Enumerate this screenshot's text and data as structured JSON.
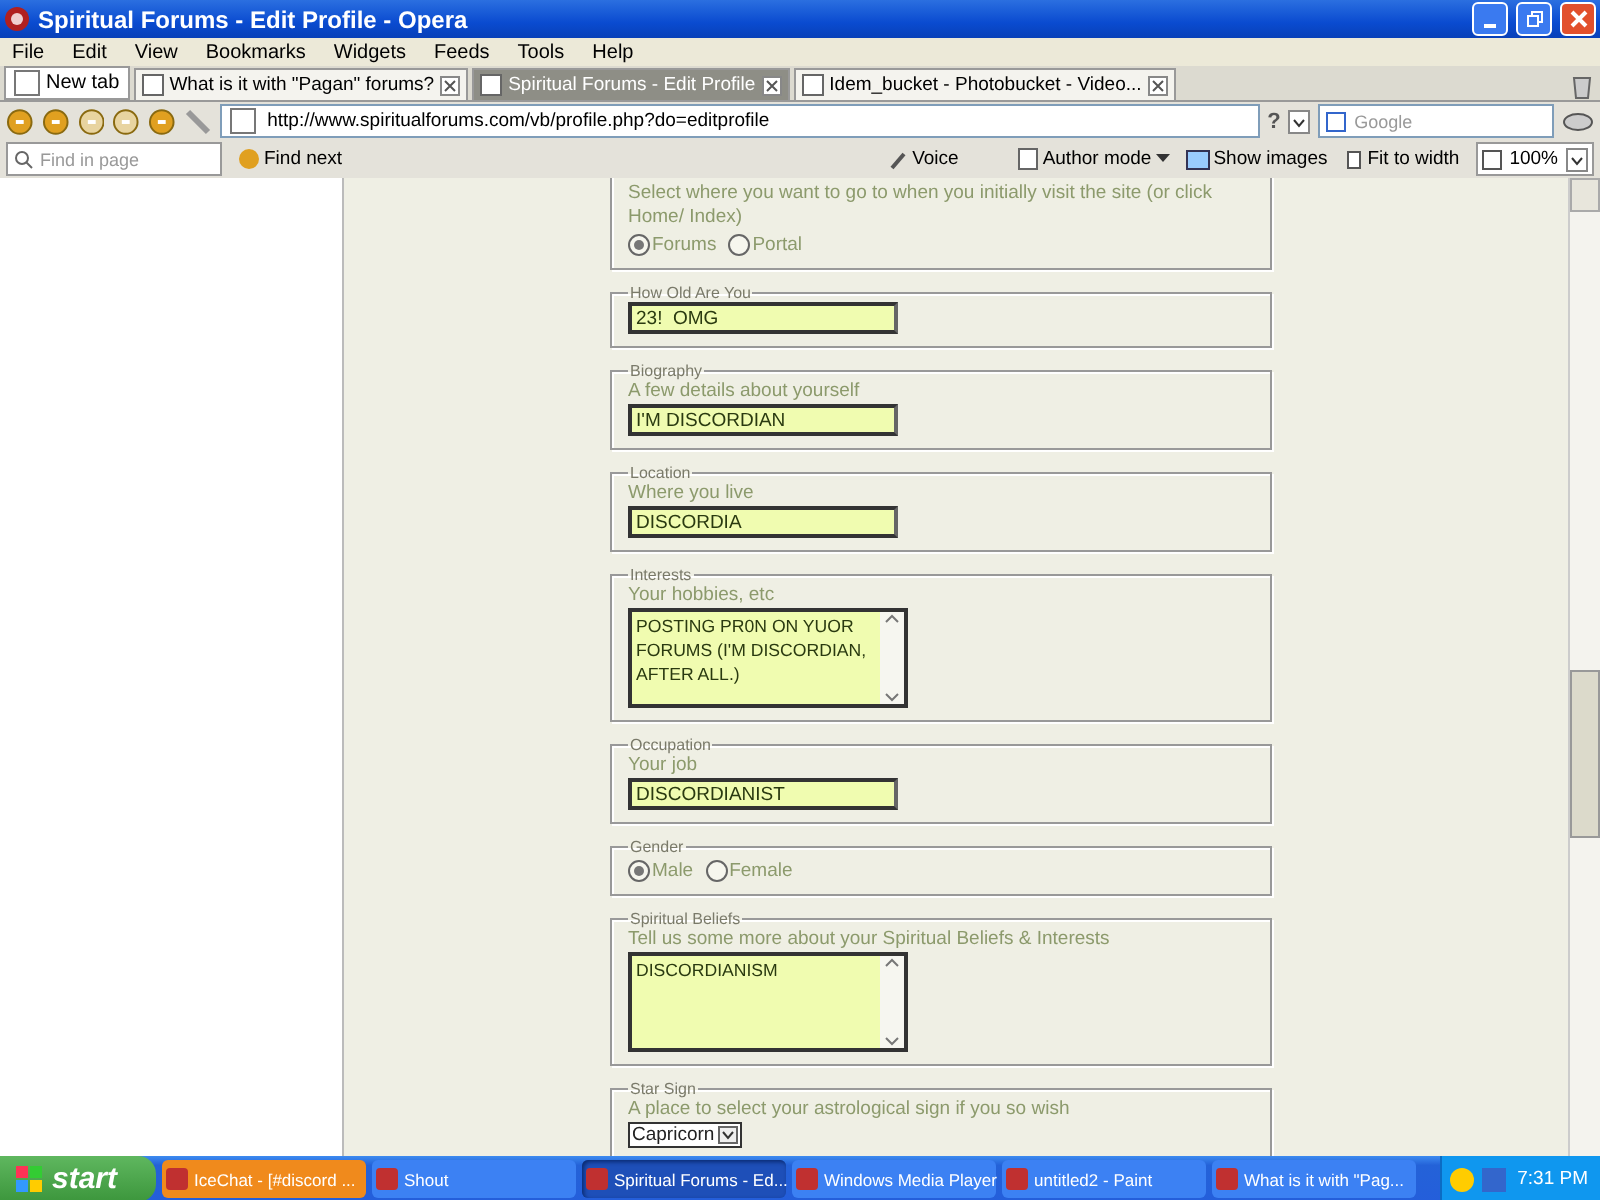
{
  "window": {
    "title": "Spiritual Forums - Edit Profile - Opera"
  },
  "menu": [
    "File",
    "Edit",
    "View",
    "Bookmarks",
    "Widgets",
    "Feeds",
    "Tools",
    "Help"
  ],
  "new_tab": "New tab",
  "tabs": [
    {
      "label": "What is it with \"Pagan\" forums?",
      "selected": false
    },
    {
      "label": "Spiritual Forums - Edit Profile",
      "selected": true
    },
    {
      "label": "Idem_bucket - Photobucket - Video...",
      "selected": false
    }
  ],
  "address": {
    "url": "http://www.spiritualforums.com/vb/profile.php?do=editprofile",
    "help": "?",
    "search_placeholder": "Google"
  },
  "find_bar": {
    "placeholder": "Find in page",
    "find_next": "Find next",
    "voice": "Voice",
    "author_mode": "Author mode",
    "show_images": "Show images",
    "fit_to_width": "Fit to width",
    "zoom": "100%"
  },
  "fields": [
    {
      "kind": "radio",
      "description": "Select where you want to go to when you initially visit the site (or click Home/ Index)",
      "options": [
        {
          "label": "Forums",
          "selected": true
        },
        {
          "label": "Portal",
          "selected": false
        }
      ]
    },
    {
      "kind": "text",
      "legend": "How Old Are You",
      "value": "23!  OMG"
    },
    {
      "kind": "text",
      "legend": "Biography",
      "description": "A few details about yourself",
      "value": "I'M DISCORDIAN"
    },
    {
      "kind": "text",
      "legend": "Location",
      "description": "Where you live",
      "value": "DISCORDIA"
    },
    {
      "kind": "textarea",
      "legend": "Interests",
      "description": "Your hobbies, etc",
      "value": "POSTING PR0N ON YUOR FORUMS (I'M DISCORDIAN, AFTER ALL.)"
    },
    {
      "kind": "text",
      "legend": "Occupation",
      "description": "Your job",
      "value": "DISCORDIANIST"
    },
    {
      "kind": "radio",
      "legend": "Gender",
      "options": [
        {
          "label": "Male",
          "selected": true
        },
        {
          "label": "Female",
          "selected": false
        }
      ]
    },
    {
      "kind": "textarea",
      "legend": "Spiritual Beliefs",
      "description": "Tell us some more about your Spiritual Beliefs & Interests",
      "value": "DISCORDIANISM"
    },
    {
      "kind": "select",
      "legend": "Star Sign",
      "description": "A place to select your astrological sign if you so wish",
      "value": "Capricorn"
    }
  ],
  "taskbar": {
    "start": "start",
    "items": [
      {
        "label": "IceChat - [#discord ...",
        "selected": false,
        "flashing": true
      },
      {
        "label": "Shout",
        "selected": false,
        "flashing": false
      },
      {
        "label": "Spiritual Forums - Ed...",
        "selected": true,
        "flashing": false
      },
      {
        "label": "Windows Media Player",
        "selected": false,
        "flashing": false
      },
      {
        "label": "untitled2 - Paint",
        "selected": false,
        "flashing": false
      },
      {
        "label": "What is it with \"Pag...",
        "selected": false,
        "flashing": false
      }
    ],
    "clock": "7:31 PM"
  }
}
